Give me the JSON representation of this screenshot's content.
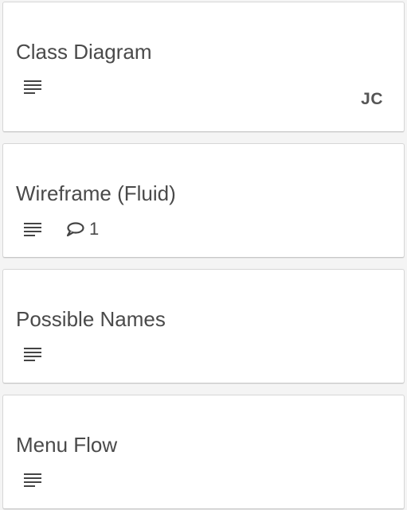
{
  "cards": [
    {
      "title": "Class Diagram",
      "has_description": true,
      "member_initials": "JC"
    },
    {
      "title": "Wireframe (Fluid)",
      "has_description": true,
      "comment_count": "1"
    },
    {
      "title": "Possible Names",
      "has_description": true
    },
    {
      "title": "Menu Flow",
      "has_description": true
    }
  ],
  "icons": {
    "description": "description-lines-icon",
    "comment": "comment-bubble-icon"
  },
  "colors": {
    "card_background": "#ffffff",
    "card_border": "#d6d6d6",
    "text": "#4a4a4a",
    "page_background": "#f4f4f4"
  }
}
